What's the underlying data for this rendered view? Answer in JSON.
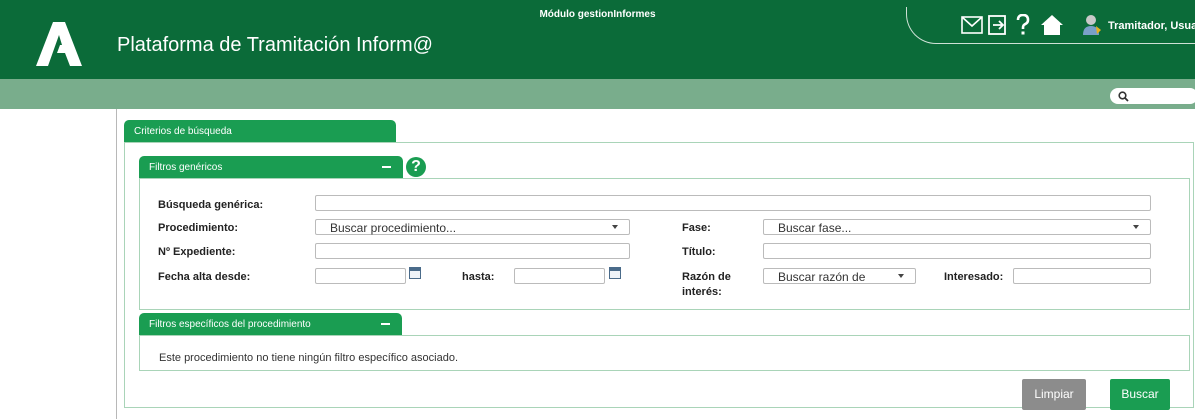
{
  "header": {
    "title": "Plataforma de Tramitación Inform@",
    "user": "Tramitador, Usuar",
    "icons": [
      "mail-icon",
      "logout-icon",
      "help-icon",
      "home-icon",
      "user-icon"
    ]
  },
  "module_bar": {
    "title": "Módulo gestionInformes"
  },
  "criteria": {
    "tab_label": "Criterios de búsqueda",
    "generic_filters": {
      "tab_label": "Filtros genéricos",
      "fields": {
        "busqueda_generica": "Búsqueda genérica:",
        "procedimiento": "Procedimiento:",
        "procedimiento_placeholder": "Buscar procedimiento...",
        "fase": "Fase:",
        "fase_placeholder": "Buscar fase...",
        "expediente": "Nº Expediente:",
        "titulo": "Título:",
        "fecha_alta_desde": "Fecha alta desde:",
        "hasta": "hasta:",
        "razon_interes_1": "Razón de",
        "razon_interes_2": "interés:",
        "razon_placeholder": "Buscar razón de",
        "interesado": "Interesado:"
      }
    },
    "specific_filters": {
      "tab_label": "Filtros específicos del procedimiento",
      "message": "Este procedimiento no tiene ningún filtro específico asociado."
    }
  },
  "buttons": {
    "clear": "Limpiar",
    "search": "Buscar"
  },
  "colors": {
    "header": "#0b6b39",
    "module_bar": "#79ad8c",
    "accent": "#1a9d52",
    "clear_button": "#8c8c8c"
  }
}
